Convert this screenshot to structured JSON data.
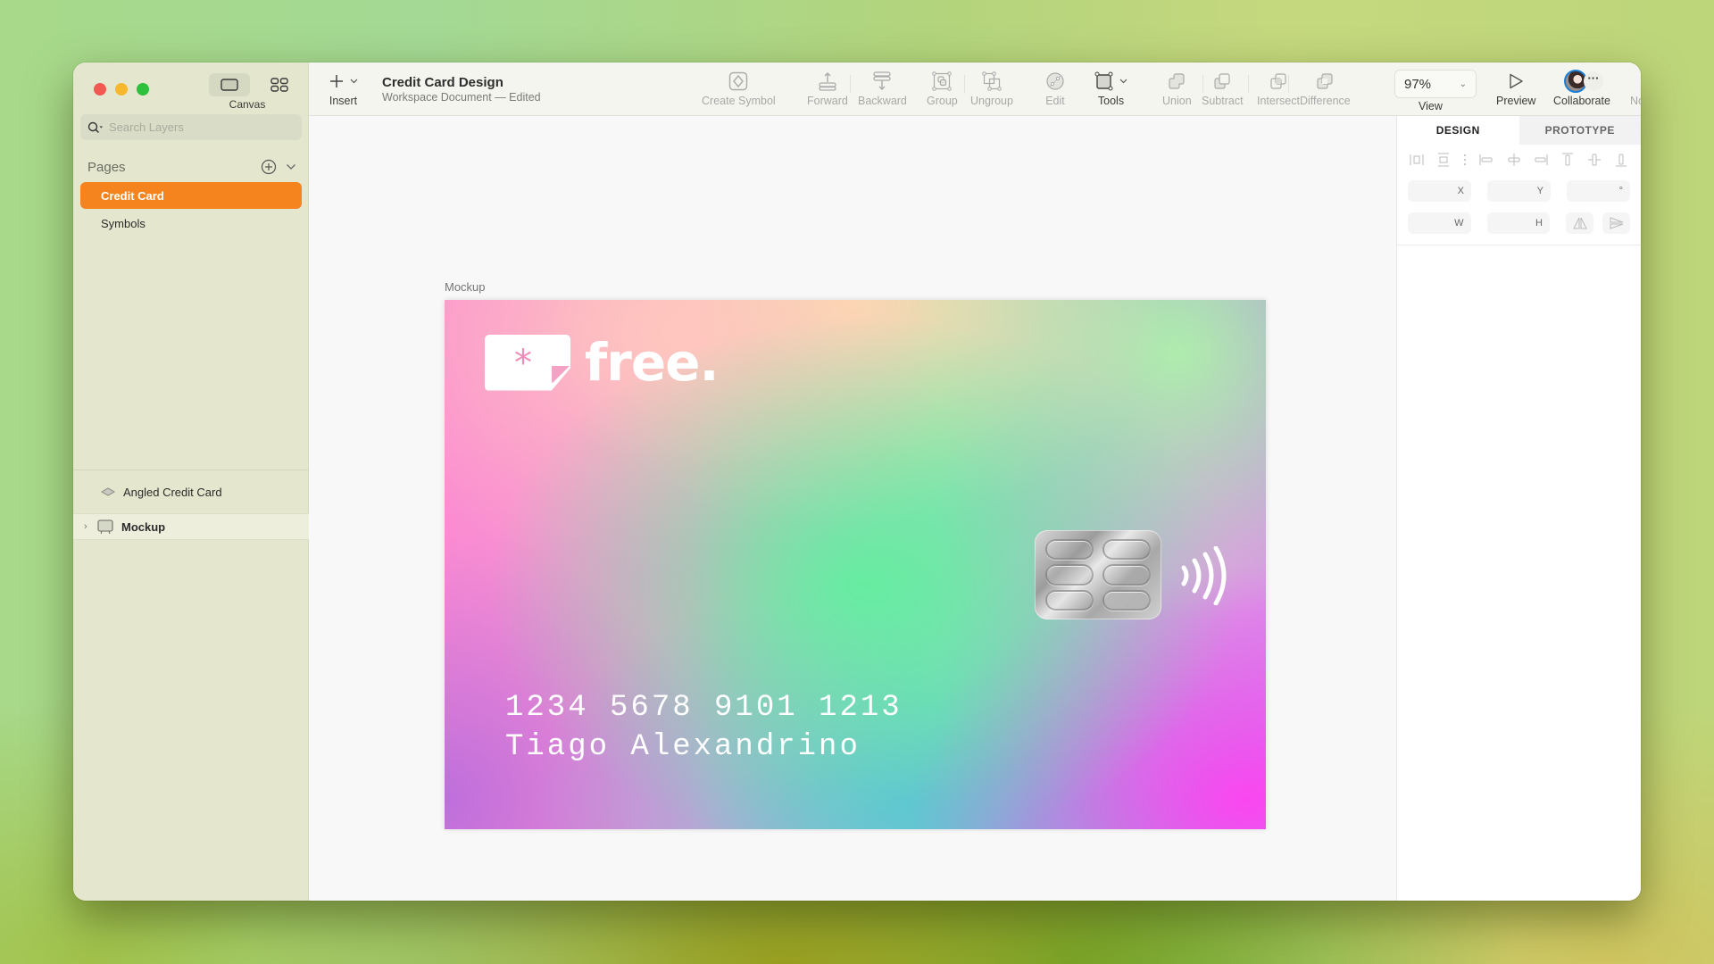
{
  "window": {
    "sidebar": {
      "view_switch": {
        "canvas_label": "Canvas"
      },
      "search": {
        "placeholder": "Search Layers"
      },
      "pages": {
        "title": "Pages",
        "items": [
          {
            "label": "Credit Card",
            "selected": true
          },
          {
            "label": "Symbols",
            "selected": false
          }
        ]
      },
      "layers": [
        {
          "label": "Angled Credit Card",
          "icon": "symbol-instance-icon",
          "expandable": false
        },
        {
          "label": "Mockup",
          "icon": "artboard-icon",
          "expandable": true,
          "selected": true
        }
      ]
    },
    "toolbar": {
      "insert_label": "Insert",
      "document_title": "Credit Card Design",
      "document_subtitle": "Workspace Document — Edited",
      "buttons": {
        "create_symbol": "Create Symbol",
        "forward": "Forward",
        "backward": "Backward",
        "group": "Group",
        "ungroup": "Ungroup",
        "edit": "Edit",
        "tools": "Tools",
        "union": "Union",
        "subtract": "Subtract",
        "intersect": "Intersect",
        "difference": "Difference",
        "preview": "Preview",
        "collaborate": "Collaborate",
        "notifications": "Notifications"
      },
      "zoom": {
        "value": "97%",
        "label": "View"
      }
    },
    "canvas": {
      "artboard_label": "Mockup",
      "card": {
        "brand": "free.",
        "brand_mark": "*",
        "number": "1234 5678 9101 1213",
        "holder": "Tiago Alexandrino"
      }
    },
    "inspector": {
      "tabs": [
        {
          "label": "DESIGN",
          "active": true
        },
        {
          "label": "PROTOTYPE",
          "active": false
        }
      ],
      "fields": {
        "x_label": "X",
        "y_label": "Y",
        "rotation_label": "°",
        "w_label": "W",
        "h_label": "H"
      }
    }
  },
  "colors": {
    "accent": "#f5841f",
    "sidebar_bg": "#e4e7cd",
    "toolbar_bg": "#f5f5ef",
    "collaborator_ring": "#1a7fd6"
  }
}
